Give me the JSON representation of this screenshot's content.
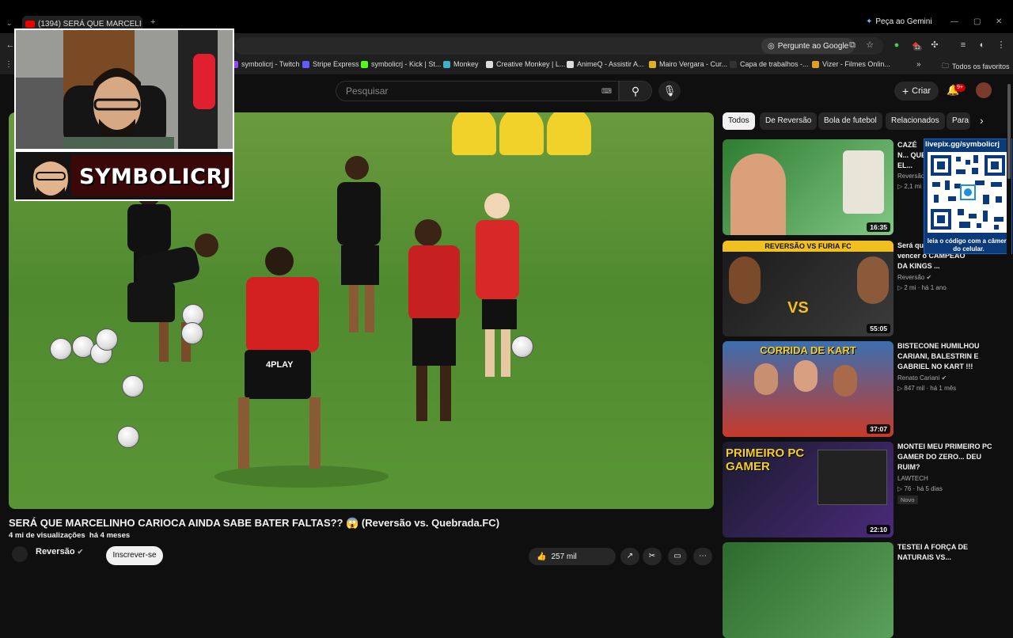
{
  "browser": {
    "tab_title": "(1394) SERÁ QUE MARCELI",
    "gemini_label": "Peça ao Gemini",
    "ask_google_label": "Pergunte ao Google",
    "bookmarks": [
      {
        "label": "symbolicrj - Twitch",
        "color": "#9146ff"
      },
      {
        "label": "Stripe Express",
        "color": "#635bff"
      },
      {
        "label": "symbolicrj - Kick | St...",
        "color": "#53fc18"
      },
      {
        "label": "Monkey",
        "color": "#3fb0c9"
      },
      {
        "label": "Creative Monkey | L...",
        "color": "#dddddd"
      },
      {
        "label": "AnimeQ - Assistir A...",
        "color": "#dddddd"
      },
      {
        "label": "Mairo Vergara - Cur...",
        "color": "#e0b020"
      },
      {
        "label": "Capa de trabalhos -...",
        "color": "#333333"
      },
      {
        "label": "Vizer - Filmes Onlin...",
        "color": "#e0a020"
      }
    ],
    "all_bookmarks_label": "Todos os favoritos",
    "extension_badge": "12"
  },
  "youtube": {
    "search_placeholder": "Pesquisar",
    "create_label": "Criar",
    "notification_count": "9+"
  },
  "overlay": {
    "streamer_name": "SYMBOLICRJ",
    "qr_url": "livepix.gg/symbolicrj",
    "qr_hint": "leia o código com a câmera do celular."
  },
  "video": {
    "title": "SERÁ QUE MARCELINHO CARIOCA AINDA SABE BATER FALTAS?? 😱 (Reversão vs. Quebrada.FC)",
    "views": "4 mi de visualizações",
    "age": "há 4 meses",
    "channel": "Reversão",
    "subscribe_label": "Inscrever-se",
    "likes": "257 mil",
    "jersey_text": "4PLAY"
  },
  "chips": [
    "Todos",
    "De Reversão",
    "Bola de futebol",
    "Relacionados",
    "Para"
  ],
  "recommendations": [
    {
      "title": "CAZÉ N... QUE EL... BOLA?...",
      "channel": "Reversão",
      "meta": "2,1 mi",
      "duration": "16:35",
      "colors": [
        "#2e7d32",
        "#81c784"
      ]
    },
    {
      "title": "Será qu... conseguem vencer o CAMPEÃO DA KINGS ...",
      "channel": "Reversão",
      "meta": "2 mi  ·  há 1 ano",
      "duration": "55:05",
      "banner": "REVERSÃO VS FURIA FC",
      "colors": [
        "#1a1a1a",
        "#3b3b3b"
      ]
    },
    {
      "title": "BISTECONE HUMILHOU CARIANI, BALESTRIN E GABRIEL NO KART !!!",
      "channel": "Renato Cariani",
      "meta": "847 mil  ·  há 1 mês",
      "duration": "37:07",
      "banner": "CORRIDA DE KART",
      "colors": [
        "#3a6fb0",
        "#c73a2a"
      ]
    },
    {
      "title": "MONTEI MEU PRIMEIRO PC GAMER DO ZERO... DEU RUIM?",
      "channel": "LAWTECH",
      "meta": "76  ·  há 5 dias",
      "duration": "22:10",
      "banner": "PRIMEIRO PC GAMER",
      "badge": "Novo",
      "colors": [
        "#1b1b2e",
        "#4a2a7a"
      ]
    },
    {
      "title": "TESTEI A FORÇA DE NATURAIS VS...",
      "colors": [
        "#2e6b2e",
        "#5aa05a"
      ]
    }
  ]
}
